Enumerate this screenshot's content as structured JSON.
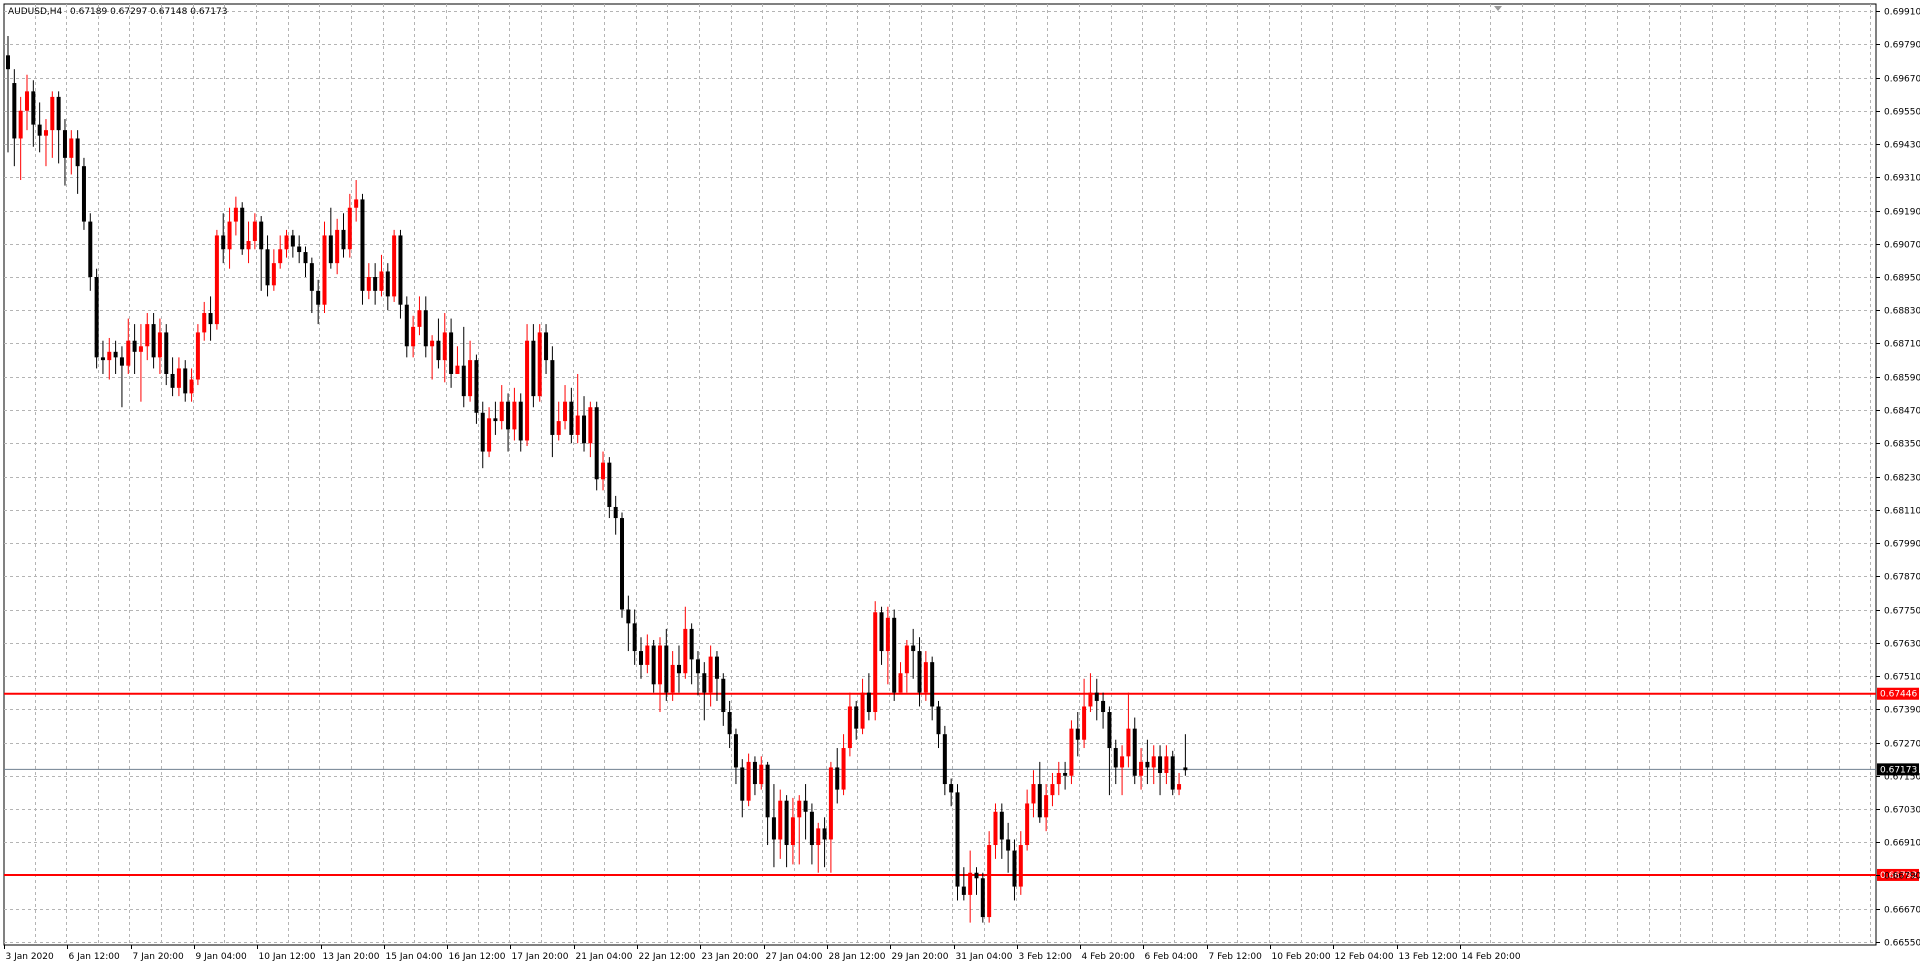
{
  "window": {
    "info_symbol": "AUDUSD,H4",
    "info_ohlc": "0.67189 0.67297 0.67148 0.67173"
  },
  "colors": {
    "background": "#ffffff",
    "grid": "#b4b4b4",
    "bull_candle": "#ff0000",
    "bear_candle": "#000000",
    "level_line": "#ff0000",
    "bid_line": "#708090",
    "doji_candle": "#00c000"
  },
  "chart_data": {
    "type": "candlestick",
    "title": "AUDUSD,H4",
    "ylim": [
      0.6655,
      0.6993
    ],
    "y_ticks": [
      "0.69910",
      "0.69790",
      "0.69670",
      "0.69550",
      "0.69430",
      "0.69310",
      "0.69190",
      "0.69070",
      "0.68950",
      "0.68830",
      "0.68710",
      "0.68590",
      "0.68470",
      "0.68350",
      "0.68230",
      "0.68110",
      "0.67990",
      "0.67870",
      "0.67750",
      "0.67630",
      "0.67510",
      "0.67390",
      "0.67270",
      "0.67150",
      "0.67030",
      "0.66910",
      "0.66790",
      "0.66670",
      "0.66550"
    ],
    "x_ticks": [
      "3 Jan 2020",
      "6 Jan 12:00",
      "7 Jan 20:00",
      "9 Jan 04:00",
      "10 Jan 12:00",
      "13 Jan 20:00",
      "15 Jan 04:00",
      "16 Jan 12:00",
      "17 Jan 20:00",
      "21 Jan 04:00",
      "22 Jan 12:00",
      "23 Jan 20:00",
      "27 Jan 04:00",
      "28 Jan 12:00",
      "29 Jan 20:00",
      "31 Jan 04:00",
      "3 Feb 12:00",
      "4 Feb 20:00",
      "6 Feb 04:00",
      "7 Feb 12:00",
      "10 Feb 20:00",
      "12 Feb 04:00",
      "13 Feb 12:00",
      "14 Feb 20:00"
    ],
    "horizontal_levels": [
      {
        "value": 0.67446,
        "label": "0.67446"
      },
      {
        "value": 0.66792,
        "label": "0.66792"
      }
    ],
    "current_price": {
      "value": 0.67173,
      "label": "0.67173"
    },
    "candles": [
      [
        0.6975,
        0.697,
        0.6982,
        0.694
      ],
      [
        0.6965,
        0.6945,
        0.697,
        0.6935
      ],
      [
        0.6945,
        0.6955,
        0.696,
        0.693
      ],
      [
        0.6955,
        0.6962,
        0.6968,
        0.6948
      ],
      [
        0.6962,
        0.695,
        0.6966,
        0.6942
      ],
      [
        0.695,
        0.6946,
        0.6958,
        0.694
      ],
      [
        0.6946,
        0.6948,
        0.6952,
        0.6935
      ],
      [
        0.6948,
        0.696,
        0.6962,
        0.6938
      ],
      [
        0.696,
        0.6948,
        0.6962,
        0.6936
      ],
      [
        0.6948,
        0.6938,
        0.6952,
        0.6928
      ],
      [
        0.6938,
        0.6945,
        0.6948,
        0.6932
      ],
      [
        0.6945,
        0.6935,
        0.6948,
        0.6925
      ],
      [
        0.6935,
        0.6915,
        0.6938,
        0.6912
      ],
      [
        0.6915,
        0.6895,
        0.6918,
        0.689
      ],
      [
        0.6895,
        0.6866,
        0.6898,
        0.6862
      ],
      [
        0.6866,
        0.6865,
        0.6872,
        0.686
      ],
      [
        0.6865,
        0.6868,
        0.6873,
        0.6858
      ],
      [
        0.6868,
        0.6866,
        0.6872,
        0.686
      ],
      [
        0.6866,
        0.6863,
        0.687,
        0.6848
      ],
      [
        0.6863,
        0.6872,
        0.688,
        0.686
      ],
      [
        0.6872,
        0.6868,
        0.6878,
        0.686
      ],
      [
        0.6868,
        0.687,
        0.6878,
        0.685
      ],
      [
        0.687,
        0.6878,
        0.6882,
        0.6865
      ],
      [
        0.6878,
        0.6866,
        0.6882,
        0.6862
      ],
      [
        0.6866,
        0.6875,
        0.688,
        0.686
      ],
      [
        0.6875,
        0.686,
        0.6878,
        0.6856
      ],
      [
        0.686,
        0.6855,
        0.6866,
        0.6852
      ],
      [
        0.6855,
        0.6862,
        0.6866,
        0.6852
      ],
      [
        0.6862,
        0.6853,
        0.6865,
        0.685
      ],
      [
        0.6853,
        0.6858,
        0.6862,
        0.685
      ],
      [
        0.6858,
        0.6875,
        0.6878,
        0.6856
      ],
      [
        0.6875,
        0.6882,
        0.6886,
        0.6872
      ],
      [
        0.6882,
        0.6878,
        0.6888,
        0.6872
      ],
      [
        0.6878,
        0.691,
        0.6912,
        0.6876
      ],
      [
        0.691,
        0.6905,
        0.6918,
        0.69
      ],
      [
        0.6905,
        0.6915,
        0.692,
        0.6898
      ],
      [
        0.6915,
        0.692,
        0.6924,
        0.691
      ],
      [
        0.692,
        0.6905,
        0.6922,
        0.6903
      ],
      [
        0.6905,
        0.6908,
        0.6915,
        0.69
      ],
      [
        0.6908,
        0.6915,
        0.6918,
        0.6905
      ],
      [
        0.6915,
        0.6905,
        0.6917,
        0.689
      ],
      [
        0.6905,
        0.6892,
        0.691,
        0.6888
      ],
      [
        0.6892,
        0.69,
        0.6905,
        0.689
      ],
      [
        0.69,
        0.6905,
        0.691,
        0.6898
      ],
      [
        0.6905,
        0.691,
        0.6912,
        0.6902
      ],
      [
        0.691,
        0.6906,
        0.6912,
        0.6902
      ],
      [
        0.6906,
        0.6904,
        0.691,
        0.69
      ],
      [
        0.6904,
        0.69,
        0.6906,
        0.6895
      ],
      [
        0.69,
        0.689,
        0.6902,
        0.6882
      ],
      [
        0.689,
        0.6885,
        0.6894,
        0.6878
      ],
      [
        0.6885,
        0.691,
        0.6915,
        0.6882
      ],
      [
        0.691,
        0.69,
        0.692,
        0.6898
      ],
      [
        0.69,
        0.6912,
        0.6916,
        0.6896
      ],
      [
        0.6912,
        0.6905,
        0.6918,
        0.6902
      ],
      [
        0.6905,
        0.692,
        0.6925,
        0.6902
      ],
      [
        0.692,
        0.6923,
        0.693,
        0.6915
      ],
      [
        0.6923,
        0.689,
        0.6925,
        0.6885
      ],
      [
        0.689,
        0.6895,
        0.69,
        0.6887
      ],
      [
        0.6895,
        0.689,
        0.69,
        0.6885
      ],
      [
        0.689,
        0.6897,
        0.6903,
        0.6888
      ],
      [
        0.6897,
        0.6888,
        0.69,
        0.6883
      ],
      [
        0.6888,
        0.691,
        0.6912,
        0.6886
      ],
      [
        0.691,
        0.6885,
        0.6912,
        0.688
      ],
      [
        0.6885,
        0.687,
        0.6888,
        0.6866
      ],
      [
        0.687,
        0.6877,
        0.6881,
        0.6866
      ],
      [
        0.6877,
        0.6883,
        0.6888,
        0.6874
      ],
      [
        0.6883,
        0.687,
        0.6888,
        0.6866
      ],
      [
        0.687,
        0.6872,
        0.6874,
        0.6858
      ],
      [
        0.6872,
        0.6865,
        0.688,
        0.6862
      ],
      [
        0.6865,
        0.6875,
        0.6882,
        0.6857
      ],
      [
        0.6875,
        0.686,
        0.688,
        0.6855
      ],
      [
        0.686,
        0.6863,
        0.687,
        0.686
      ],
      [
        0.6863,
        0.6852,
        0.6877,
        0.6848
      ],
      [
        0.6852,
        0.6865,
        0.6872,
        0.685
      ],
      [
        0.6865,
        0.6846,
        0.6867,
        0.6842
      ],
      [
        0.6846,
        0.6832,
        0.685,
        0.6826
      ],
      [
        0.6832,
        0.6844,
        0.6848,
        0.683
      ],
      [
        0.6844,
        0.6843,
        0.685,
        0.6838
      ],
      [
        0.6843,
        0.685,
        0.6856,
        0.684
      ],
      [
        0.685,
        0.684,
        0.6853,
        0.6832
      ],
      [
        0.684,
        0.685,
        0.6855,
        0.6836
      ],
      [
        0.685,
        0.6836,
        0.6853,
        0.6832
      ],
      [
        0.6836,
        0.6872,
        0.6878,
        0.6834
      ],
      [
        0.6872,
        0.6852,
        0.6878,
        0.6848
      ],
      [
        0.6852,
        0.6875,
        0.6878,
        0.685
      ],
      [
        0.6875,
        0.6865,
        0.6878,
        0.686
      ],
      [
        0.6865,
        0.6838,
        0.687,
        0.683
      ],
      [
        0.6838,
        0.6843,
        0.685,
        0.6836
      ],
      [
        0.6843,
        0.685,
        0.6856,
        0.684
      ],
      [
        0.685,
        0.6838,
        0.6855,
        0.6835
      ],
      [
        0.6838,
        0.6845,
        0.686,
        0.6835
      ],
      [
        0.6845,
        0.6835,
        0.6852,
        0.6832
      ],
      [
        0.6835,
        0.6848,
        0.685,
        0.683
      ],
      [
        0.6848,
        0.6822,
        0.685,
        0.6818
      ],
      [
        0.6822,
        0.6828,
        0.6832,
        0.6818
      ],
      [
        0.6828,
        0.6812,
        0.683,
        0.6808
      ],
      [
        0.6812,
        0.6808,
        0.6816,
        0.6802
      ],
      [
        0.6808,
        0.6775,
        0.681,
        0.6772
      ],
      [
        0.6775,
        0.677,
        0.678,
        0.676
      ],
      [
        0.677,
        0.676,
        0.6775,
        0.6755
      ],
      [
        0.676,
        0.6755,
        0.6765,
        0.675
      ],
      [
        0.6755,
        0.6762,
        0.6766,
        0.6752
      ],
      [
        0.6762,
        0.6748,
        0.6764,
        0.6745
      ],
      [
        0.6748,
        0.6762,
        0.6765,
        0.6738
      ],
      [
        0.6762,
        0.6745,
        0.6768,
        0.6742
      ],
      [
        0.6745,
        0.6755,
        0.676,
        0.6742
      ],
      [
        0.6755,
        0.6752,
        0.6762,
        0.6745
      ],
      [
        0.6752,
        0.6768,
        0.6776,
        0.675
      ],
      [
        0.6768,
        0.6757,
        0.677,
        0.6748
      ],
      [
        0.6757,
        0.6752,
        0.676,
        0.6744
      ],
      [
        0.6752,
        0.6745,
        0.6756,
        0.6735
      ],
      [
        0.6745,
        0.6758,
        0.6762,
        0.674
      ],
      [
        0.6758,
        0.675,
        0.676,
        0.6742
      ],
      [
        0.675,
        0.6738,
        0.6752,
        0.6733
      ],
      [
        0.6738,
        0.673,
        0.6742,
        0.6725
      ],
      [
        0.673,
        0.6718,
        0.6732,
        0.6712
      ],
      [
        0.6718,
        0.6706,
        0.6721,
        0.67
      ],
      [
        0.6706,
        0.672,
        0.6723,
        0.6704
      ],
      [
        0.672,
        0.6712,
        0.6722,
        0.6708
      ],
      [
        0.6712,
        0.6719,
        0.6722,
        0.671
      ],
      [
        0.6719,
        0.67,
        0.672,
        0.669
      ],
      [
        0.67,
        0.6692,
        0.6712,
        0.6682
      ],
      [
        0.6692,
        0.6706,
        0.671,
        0.6685
      ],
      [
        0.6706,
        0.669,
        0.6708,
        0.6682
      ],
      [
        0.669,
        0.67,
        0.6707,
        0.6683
      ],
      [
        0.67,
        0.6706,
        0.6708,
        0.6683
      ],
      [
        0.6706,
        0.6702,
        0.6712,
        0.6692
      ],
      [
        0.6702,
        0.669,
        0.6705,
        0.6683
      ],
      [
        0.669,
        0.6696,
        0.6698,
        0.668
      ],
      [
        0.6696,
        0.6692,
        0.67,
        0.6682
      ],
      [
        0.6692,
        0.6718,
        0.672,
        0.668
      ],
      [
        0.6718,
        0.671,
        0.6725,
        0.6705
      ],
      [
        0.671,
        0.6725,
        0.673,
        0.6708
      ],
      [
        0.6725,
        0.674,
        0.6745,
        0.6722
      ],
      [
        0.674,
        0.6732,
        0.6742,
        0.6728
      ],
      [
        0.6732,
        0.6745,
        0.675,
        0.673
      ],
      [
        0.6745,
        0.6738,
        0.6752,
        0.6735
      ],
      [
        0.6738,
        0.6774,
        0.6778,
        0.6735
      ],
      [
        0.6774,
        0.676,
        0.6776,
        0.6755
      ],
      [
        0.676,
        0.6772,
        0.6776,
        0.6748
      ],
      [
        0.6772,
        0.6745,
        0.6775,
        0.6742
      ],
      [
        0.6745,
        0.6752,
        0.6756,
        0.6745
      ],
      [
        0.6752,
        0.6762,
        0.6764,
        0.6745
      ],
      [
        0.6762,
        0.676,
        0.6768,
        0.675
      ],
      [
        0.676,
        0.6745,
        0.6765,
        0.674
      ],
      [
        0.6745,
        0.6756,
        0.676,
        0.6742
      ],
      [
        0.6756,
        0.674,
        0.6758,
        0.6735
      ],
      [
        0.674,
        0.673,
        0.6742,
        0.6725
      ],
      [
        0.673,
        0.6712,
        0.6733,
        0.6708
      ],
      [
        0.6712,
        0.6709,
        0.6714,
        0.6704
      ],
      [
        0.6709,
        0.6675,
        0.6712,
        0.667
      ],
      [
        0.6675,
        0.6672,
        0.6682,
        0.667
      ],
      [
        0.6672,
        0.668,
        0.6688,
        0.6662
      ],
      [
        0.668,
        0.6678,
        0.6682,
        0.6672
      ],
      [
        0.6678,
        0.6664,
        0.668,
        0.6662
      ],
      [
        0.6664,
        0.669,
        0.6695,
        0.6662
      ],
      [
        0.669,
        0.6702,
        0.6705,
        0.6685
      ],
      [
        0.6702,
        0.6692,
        0.6705,
        0.6685
      ],
      [
        0.6692,
        0.6688,
        0.6698,
        0.668
      ],
      [
        0.6688,
        0.6675,
        0.6692,
        0.667
      ],
      [
        0.6675,
        0.669,
        0.6695,
        0.6672
      ],
      [
        0.669,
        0.6705,
        0.671,
        0.6688
      ],
      [
        0.6705,
        0.6712,
        0.6717,
        0.67
      ],
      [
        0.6712,
        0.67,
        0.672,
        0.6698
      ],
      [
        0.67,
        0.6708,
        0.6712,
        0.6695
      ],
      [
        0.6708,
        0.6712,
        0.6716,
        0.6704
      ],
      [
        0.6712,
        0.6716,
        0.672,
        0.6708
      ],
      [
        0.6716,
        0.6715,
        0.672,
        0.671
      ],
      [
        0.6715,
        0.6732,
        0.6735,
        0.6712
      ],
      [
        0.6732,
        0.6728,
        0.6738,
        0.6722
      ],
      [
        0.6728,
        0.674,
        0.675,
        0.6725
      ],
      [
        0.674,
        0.6745,
        0.6752,
        0.6738
      ],
      [
        0.6745,
        0.6742,
        0.675,
        0.6735
      ],
      [
        0.6742,
        0.6738,
        0.6745,
        0.6732
      ],
      [
        0.6738,
        0.6725,
        0.674,
        0.6708
      ],
      [
        0.6725,
        0.6718,
        0.6728,
        0.6712
      ],
      [
        0.6718,
        0.6722,
        0.6726,
        0.6708
      ],
      [
        0.6722,
        0.6732,
        0.6745,
        0.6718
      ],
      [
        0.6732,
        0.6715,
        0.6736,
        0.6712
      ],
      [
        0.6715,
        0.672,
        0.6725,
        0.671
      ],
      [
        0.672,
        0.6718,
        0.6728,
        0.6712
      ],
      [
        0.6718,
        0.6722,
        0.6726,
        0.6712
      ],
      [
        0.6722,
        0.6716,
        0.6726,
        0.6708
      ],
      [
        0.6716,
        0.6722,
        0.6726,
        0.6712
      ],
      [
        0.6722,
        0.671,
        0.6724,
        0.6708
      ],
      [
        0.671,
        0.6712,
        0.6716,
        0.6708
      ],
      [
        0.6718,
        0.6717,
        0.673,
        0.6715
      ]
    ]
  }
}
